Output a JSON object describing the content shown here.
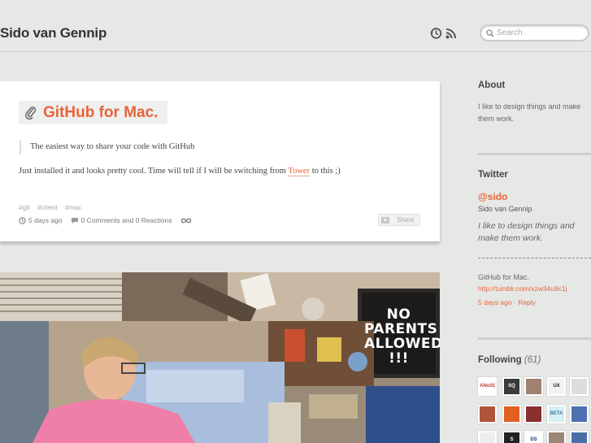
{
  "site": {
    "title": "Sido van Gennip"
  },
  "header": {
    "icons": [
      "history-icon",
      "rss-icon"
    ]
  },
  "search": {
    "placeholder": "Search"
  },
  "post": {
    "title": "GitHub for Mac.",
    "quote": "The easiest way to share your code with GitHub",
    "body_before": "Just installed it and looks pretty cool. Time will tell if I will be switching from ",
    "body_link": "Tower",
    "body_after": " to this ;)",
    "tags": [
      "#git",
      "#client",
      "#mac"
    ],
    "time": "5 days ago",
    "comments": "0 Comments and 0 Reactions",
    "share_label": "Share"
  },
  "photo": {
    "sign_text": "NO PARENTS ALLOWED !!!"
  },
  "sidebar": {
    "about": {
      "heading": "About",
      "text": "I like to design things and make them work."
    },
    "twitter": {
      "heading": "Twitter",
      "handle": "@sido",
      "name": "Sido van Gennip",
      "bio": "I like to design things and make them work.",
      "tweet_text": "GitHub for Mac.",
      "tweet_link": "http://tumblr.com/xzw34u9c1j",
      "tweet_time": "5 days ago",
      "tweet_sep": "·",
      "reply": "Reply"
    },
    "following": {
      "heading": "Following",
      "count": "(61)",
      "thumbs": [
        {
          "label": "ANoSQ",
          "bg": "#ffffff",
          "fg": "#c0392b"
        },
        {
          "label": "SQ",
          "bg": "#3a3a3a",
          "fg": "#ffffff"
        },
        {
          "label": "",
          "bg": "#a08070",
          "fg": "#ffffff"
        },
        {
          "label": "UX RAVE",
          "bg": "#f2f2f2",
          "fg": "#222222"
        },
        {
          "label": "",
          "bg": "#dddddd",
          "fg": "#333333"
        },
        {
          "label": "",
          "bg": "#b0563a",
          "fg": "#ffffff"
        },
        {
          "label": "",
          "bg": "#e06020",
          "fg": "#ffffff"
        },
        {
          "label": "",
          "bg": "#8a3030",
          "fg": "#ffffff"
        },
        {
          "label": "BETA LIST",
          "bg": "#d8eef5",
          "fg": "#3b7fa0"
        },
        {
          "label": "",
          "bg": "#5070b0",
          "fg": "#ffffff"
        },
        {
          "label": "",
          "bg": "#eeeeee",
          "fg": "#333333"
        },
        {
          "label": "S",
          "bg": "#222222",
          "fg": "#ffffff"
        },
        {
          "label": "DS",
          "bg": "#ffffff",
          "fg": "#1b3b7a"
        },
        {
          "label": "",
          "bg": "#998877",
          "fg": "#ffffff"
        },
        {
          "label": "",
          "bg": "#4a6ea8",
          "fg": "#ffffff"
        }
      ]
    }
  },
  "colors": {
    "accent": "#e8643c",
    "background": "#e6e8e6",
    "card": "#ffffff"
  }
}
